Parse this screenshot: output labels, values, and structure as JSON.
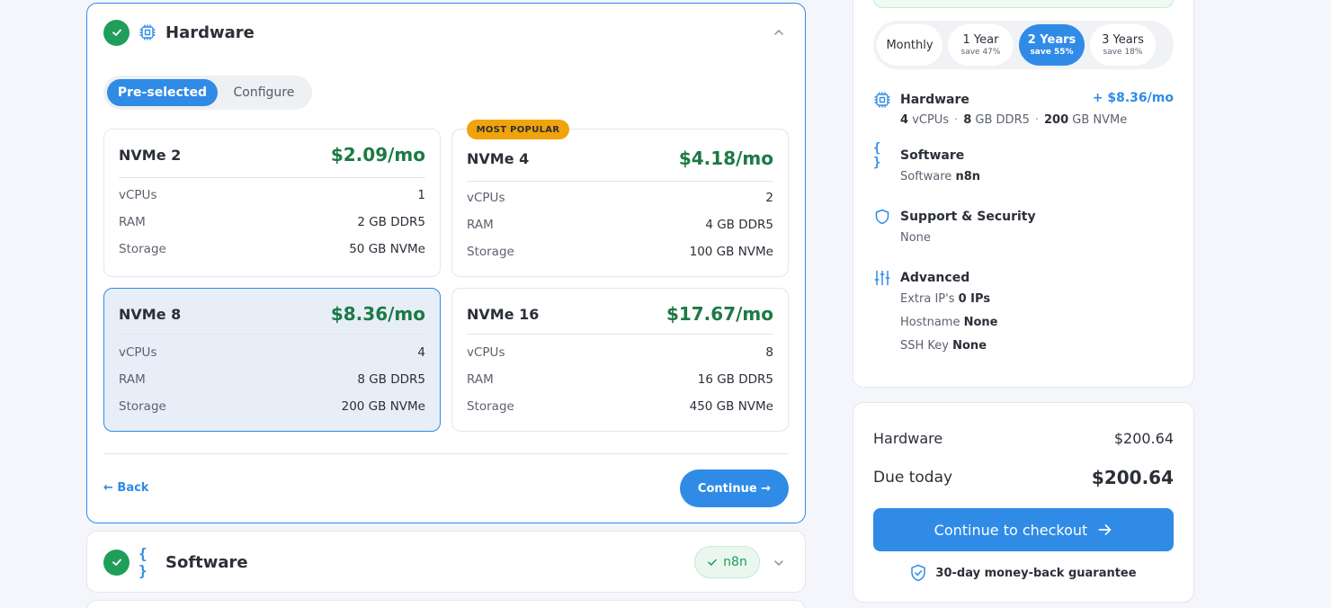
{
  "hardware_section": {
    "title": "Hardware",
    "mode_tabs": [
      "Pre-selected",
      "Configure"
    ],
    "popular_badge": "MOST POPULAR",
    "plans": [
      {
        "name": "NVMe 2",
        "price": "$2.09/mo",
        "specs": [
          {
            "label": "vCPUs",
            "value": "1"
          },
          {
            "label": "RAM",
            "value": "2 GB DDR5"
          },
          {
            "label": "Storage",
            "value": "50 GB NVMe"
          }
        ]
      },
      {
        "name": "NVMe 4",
        "price": "$4.18/mo",
        "specs": [
          {
            "label": "vCPUs",
            "value": "2"
          },
          {
            "label": "RAM",
            "value": "4 GB DDR5"
          },
          {
            "label": "Storage",
            "value": "100 GB NVMe"
          }
        ]
      },
      {
        "name": "NVMe 8",
        "price": "$8.36/mo",
        "specs": [
          {
            "label": "vCPUs",
            "value": "4"
          },
          {
            "label": "RAM",
            "value": "8 GB DDR5"
          },
          {
            "label": "Storage",
            "value": "200 GB NVMe"
          }
        ]
      },
      {
        "name": "NVMe 16",
        "price": "$17.67/mo",
        "specs": [
          {
            "label": "vCPUs",
            "value": "8"
          },
          {
            "label": "RAM",
            "value": "16 GB DDR5"
          },
          {
            "label": "Storage",
            "value": "450 GB NVMe"
          }
        ]
      }
    ],
    "selected_plan": "NVMe 8",
    "back_label": "← Back",
    "continue_label": "Continue →"
  },
  "software_section": {
    "title": "Software",
    "chip_label": "n8n"
  },
  "summary": {
    "terms": [
      {
        "main": "Monthly",
        "sub": ""
      },
      {
        "main": "1 Year",
        "sub": "save 47%"
      },
      {
        "main": "2 Years",
        "sub": "save 55%"
      },
      {
        "main": "3 Years",
        "sub": "save 18%"
      }
    ],
    "active_term": "2 Years",
    "hardware": {
      "title": "Hardware",
      "price": "+ $8.36/mo",
      "vcpu_num": "4",
      "vcpu_unit": "vCPUs",
      "ram_num": "8",
      "ram_unit": "GB DDR5",
      "storage_num": "200",
      "storage_unit": "GB NVMe"
    },
    "software": {
      "title": "Software",
      "label": "Software",
      "value": "n8n"
    },
    "support": {
      "title": "Support & Security",
      "value": "None"
    },
    "advanced": {
      "title": "Advanced",
      "rows": [
        {
          "label": "Extra IP's",
          "value": "0 IPs"
        },
        {
          "label": "Hostname",
          "value": "None"
        },
        {
          "label": "SSH Key",
          "value": "None"
        }
      ]
    }
  },
  "totals": {
    "hardware_label": "Hardware",
    "hardware_value": "$200.64",
    "due_label": "Due today",
    "due_value": "$200.64",
    "checkout_label": "Continue to checkout",
    "guarantee": "30-day money-back guarantee"
  },
  "colors": {
    "accent": "#2f8be6",
    "success": "#1f9e5a",
    "price_green": "#1c7a44",
    "badge": "#f0a30a"
  }
}
